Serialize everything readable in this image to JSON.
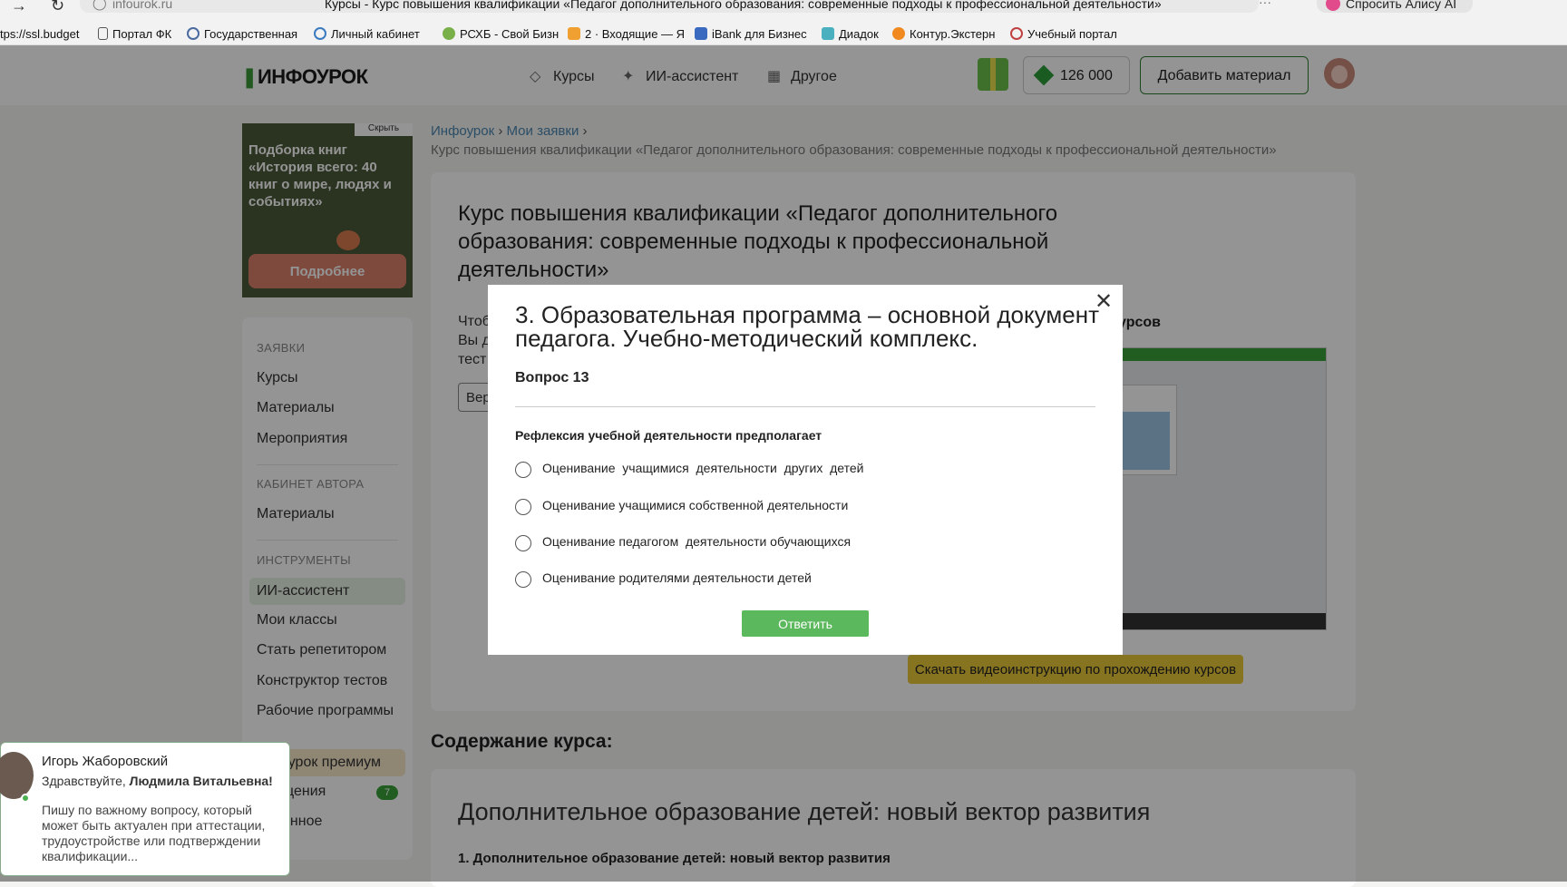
{
  "browser": {
    "url": "infourok.ru",
    "page_title": "Курсы - Курс повышения квалификации «Педагог дополнительного образования: современные подходы к профессиональной деятельности»",
    "alisa": "Спросить Алису AI",
    "bookmarks": [
      "tps://ssl.budget",
      "Портал ФК",
      "Государственная",
      "Личный кабинет",
      "РСХБ - Свой Бизн",
      "2 · Входящие — Я",
      "iBank для Бизнес",
      "Диадок",
      "Контур.Экстерн",
      "Учебный портал"
    ]
  },
  "header": {
    "logo": "ИНФОУРОК",
    "nav": [
      "Курсы",
      "ИИ-ассистент",
      "Другое"
    ],
    "coins": "126 000",
    "add_material": "Добавить материал"
  },
  "promo": {
    "hide": "Скрыть",
    "text": "Подборка книг «История всего: 40 книг о мире, людях и событиях»",
    "button": "Подробнее"
  },
  "sidebar": {
    "sections": [
      {
        "title": "ЗАЯВКИ",
        "items": [
          "Курсы",
          "Материалы",
          "Мероприятия"
        ]
      },
      {
        "title": "КАБИНЕТ АВТОРА",
        "items": [
          "Материалы"
        ]
      },
      {
        "title": "ИНСТРУМЕНТЫ",
        "items": [
          "ИИ-ассистент",
          "Мои классы",
          "Стать репетитором",
          "Конструктор тестов",
          "Рабочие программы"
        ]
      }
    ],
    "premium": "оурок премиум",
    "messages": "щения",
    "messages_badge": "7",
    "favorites": "анное"
  },
  "breadcrumbs": {
    "items": [
      "Инфоурок",
      "Мои заявки"
    ],
    "current": "Курс повышения квалификации «Педагог дополнительного образования: современные подходы к профессиональной деятельности»"
  },
  "course": {
    "title": "Курс повышения квалификации «Педагог дополнительного образования: современные подходы к профессиональной деятельности»",
    "partial_lines": [
      "Чтоб",
      "Вы д",
      "тест"
    ],
    "partial_button": "Вер",
    "video_title_partial": "урсов",
    "download_button": "Скачать видеоинструкцию по прохождению курсов"
  },
  "contents": {
    "heading": "Содержание курса:",
    "module_title": "Дополнительное образование детей: новый вектор развития",
    "module_sub": "1. Дополнительное образование детей: новый вектор развития"
  },
  "chat": {
    "name": "Игорь Жаборовский",
    "greeting": "Здравствуйте,",
    "recipient": "Людмила Витальевна!",
    "message": "Пишу по важному вопросу, который может быть актуален при аттестации, трудоустройстве или подтверждении квалификации..."
  },
  "modal": {
    "title": "3. Образовательная программа – основной документ педагога. Учебно-методический комплекс.",
    "question_number": "Вопрос 13",
    "prompt": "Рефлексия учебной деятельности предполагает",
    "options": [
      "Оценивание  учащимися  деятельности  других  детей",
      "Оценивание учащимися собственной деятельности",
      "Оценивание педагогом  деятельности обучающихся",
      "Оценивание родителями деятельности детей"
    ],
    "submit": "Ответить",
    "close_icon": "close-icon"
  }
}
